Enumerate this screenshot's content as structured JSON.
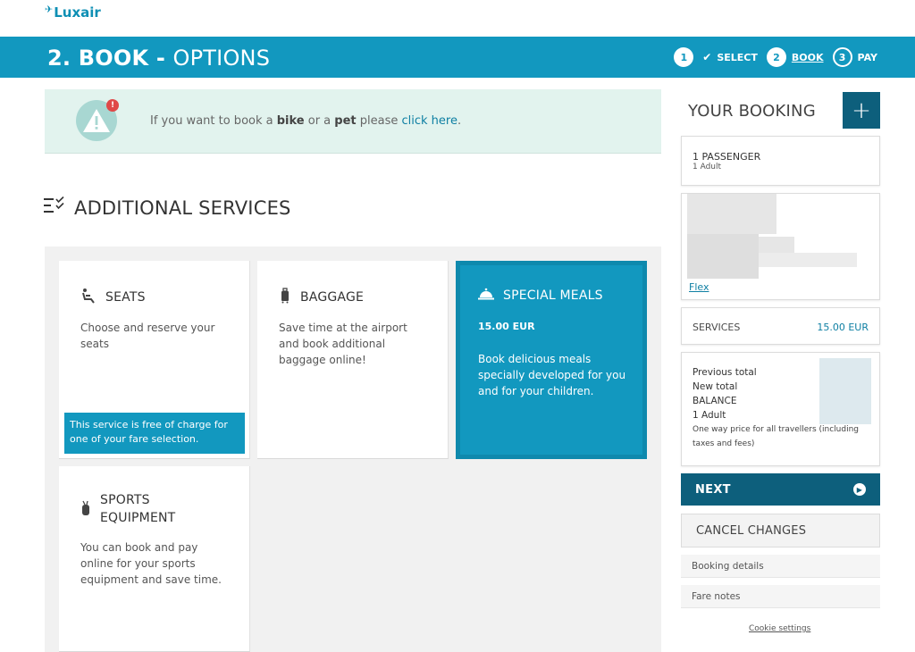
{
  "brand": {
    "name": "Luxair",
    "color": "#1298bf"
  },
  "header": {
    "title_bold": "2. BOOK - ",
    "title_light": "OPTIONS",
    "steps": [
      {
        "num": "1",
        "label": "SELECT",
        "state": "done"
      },
      {
        "num": "2",
        "label": "BOOK",
        "state": "active"
      },
      {
        "num": "3",
        "label": "PAY",
        "state": "upcoming"
      }
    ]
  },
  "notice": {
    "badge": "!",
    "pre": "If you want to book a ",
    "bike": "bike",
    "mid": " or a ",
    "pet": "pet",
    "post": " please ",
    "link": "click here",
    "end": "."
  },
  "section": {
    "title": "ADDITIONAL SERVICES"
  },
  "cards": {
    "seats": {
      "title": "SEATS",
      "desc": "Choose and reserve your seats",
      "note": "This service is free of charge for one of your fare selection."
    },
    "baggage": {
      "title": "BAGGAGE",
      "desc": "Save time at the airport and book additional baggage online!"
    },
    "meals": {
      "title": "SPECIAL MEALS",
      "price": "15.00 EUR",
      "desc": "Book delicious meals specially developed for you and for your children."
    },
    "sports": {
      "title": "SPORTS EQUIPMENT",
      "desc": "You can book and pay online for your sports equipment and save time."
    }
  },
  "booking": {
    "title": "YOUR BOOKING",
    "plus": "+",
    "passengers": "1 PASSENGER",
    "adults": "1 Adult",
    "fare": "Flex",
    "services_label": "SERVICES",
    "services_value": "15.00 EUR",
    "totals": [
      "Previous total",
      "New total",
      "BALANCE",
      "1 Adult"
    ],
    "price_note": "One way price for all travellers (including taxes and fees)",
    "next": "NEXT",
    "cancel": "CANCEL CHANGES",
    "details": "Booking details",
    "fare_notes": "Fare notes",
    "cookie": "Cookie settings"
  }
}
